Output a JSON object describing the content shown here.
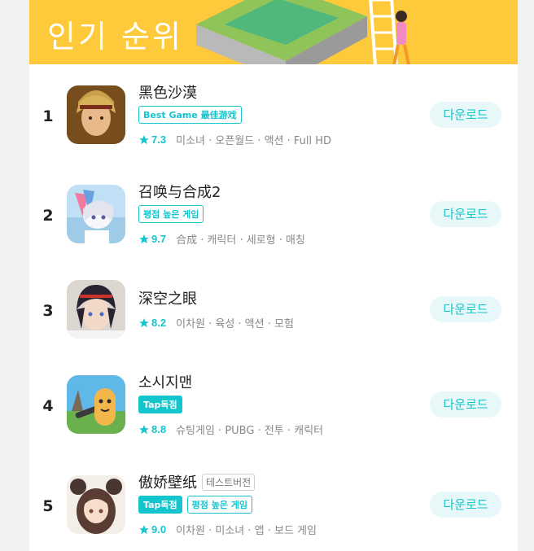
{
  "header": {
    "title": "인기 순위"
  },
  "download_label": "다운로드",
  "colors": {
    "accent": "#15c5ce",
    "banner": "#ffc93c",
    "button_bg": "#e8f8f9"
  },
  "games": [
    {
      "rank": "1",
      "name": "黑色沙漠",
      "tags": [
        {
          "text": "Best Game 最佳游戏",
          "style": "outline"
        }
      ],
      "rating": "7.3",
      "genres": "미소녀 · 오픈월드 · 액션 · Full HD"
    },
    {
      "rank": "2",
      "name": "召唤与合成2",
      "tags": [
        {
          "text": "평점 높은 게임",
          "style": "outline"
        }
      ],
      "rating": "9.7",
      "genres": "合成 · 캐릭터 · 세로형 · 매칭"
    },
    {
      "rank": "3",
      "name": "深空之眼",
      "tags": [],
      "rating": "8.2",
      "genres": "이차원 · 육성 · 액션 · 모험"
    },
    {
      "rank": "4",
      "name": "소시지맨",
      "tags": [
        {
          "text": "Tap독점",
          "style": "solid"
        }
      ],
      "rating": "8.8",
      "genres": "슈팅게임 · PUBG · 전투 · 캐릭터"
    },
    {
      "rank": "5",
      "name": "傲娇壁纸",
      "badge": "테스트버전",
      "tags": [
        {
          "text": "Tap독점",
          "style": "solid"
        },
        {
          "text": "평점 높은 게임",
          "style": "outline"
        }
      ],
      "rating": "9.0",
      "genres": "이차원 · 미소녀 · 앱 · 보드 게임"
    }
  ]
}
